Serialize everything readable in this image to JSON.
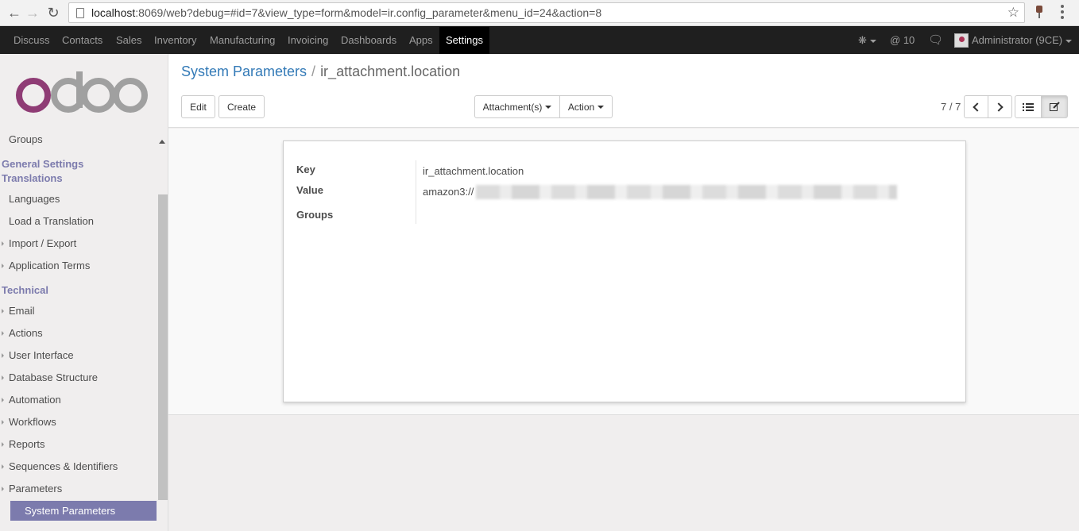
{
  "browser": {
    "url_host": "localhost",
    "url_rest": ":8069/web?debug=#id=7&view_type=form&model=ir.config_parameter&menu_id=24&action=8"
  },
  "topnav": {
    "items": [
      "Discuss",
      "Contacts",
      "Sales",
      "Inventory",
      "Manufacturing",
      "Invoicing",
      "Dashboards",
      "Apps",
      "Settings"
    ],
    "active": "Settings",
    "mentions_count": "10",
    "user": "Administrator (9CE)"
  },
  "sidebar": {
    "logo": "odoo",
    "items_top": [
      "Groups"
    ],
    "header_general": "General Settings",
    "header_translations": "Translations",
    "translations": [
      "Languages",
      "Load a Translation",
      "Import / Export",
      "Application Terms"
    ],
    "header_technical": "Technical",
    "technical": [
      "Email",
      "Actions",
      "User Interface",
      "Database Structure",
      "Automation",
      "Workflows",
      "Reports",
      "Sequences & Identifiers",
      "Parameters"
    ],
    "selected": "System Parameters"
  },
  "control_panel": {
    "breadcrumb_parent": "System Parameters",
    "breadcrumb_separator": "/",
    "breadcrumb_current": "ir_attachment.location",
    "edit_label": "Edit",
    "create_label": "Create",
    "attachments_label": "Attachment(s)",
    "action_label": "Action",
    "pager": "7 / 7"
  },
  "form": {
    "key_label": "Key",
    "key_value": "ir_attachment.location",
    "value_label": "Value",
    "value_value": "amazon3://",
    "groups_label": "Groups"
  },
  "colors": {
    "brand": "#7c7bad",
    "topnav_bg": "#1f1f1f",
    "link": "#337ab7"
  }
}
